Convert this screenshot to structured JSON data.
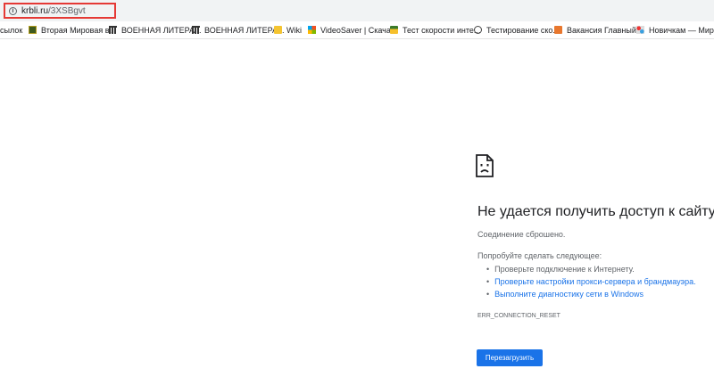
{
  "address_bar": {
    "host": "krbli.ru",
    "path": "/3XSBgvt",
    "info_icon": "info-icon"
  },
  "bookmarks": [
    {
      "label": "сылок",
      "icon": ""
    },
    {
      "label": "Вторая Мировая в...",
      "icon": "book-icon"
    },
    {
      "label": "ВОЕННАЯ ЛИТЕРА...",
      "icon": "library-icon"
    },
    {
      "label": "ВОЕННАЯ ЛИТЕРА...",
      "icon": "library-icon"
    },
    {
      "label": "Wiki",
      "icon": "folder-icon"
    },
    {
      "label": "VideoSaver | Скача...",
      "icon": "windows-icon"
    },
    {
      "label": "Тест скорости инте...",
      "icon": "speedtest-icon"
    },
    {
      "label": "Тестирование ско...",
      "icon": "globe-icon"
    },
    {
      "label": "Вакансия Главный...",
      "icon": "hh-icon"
    },
    {
      "label": "Новичкам — Мир",
      "icon": "puzzle-icon"
    }
  ],
  "error": {
    "icon": "sad-page-icon",
    "title": "Не удается получить доступ к сайту",
    "detail": "Соединение сброшено.",
    "try_label": "Попробуйте сделать следующее:",
    "suggestions": [
      {
        "text": "Проверьте подключение к Интернету.",
        "link": false
      },
      {
        "text": "Проверьте настройки прокси-сервера и брандмауэра.",
        "link": true
      },
      {
        "text": "Выполните диагностику сети в Windows",
        "link": true
      }
    ],
    "code": "ERR_CONNECTION_RESET",
    "reload_label": "Перезагрузить"
  },
  "colors": {
    "link": "#1a73e8",
    "button": "#1a73e8",
    "highlight_box": "#e53935"
  }
}
